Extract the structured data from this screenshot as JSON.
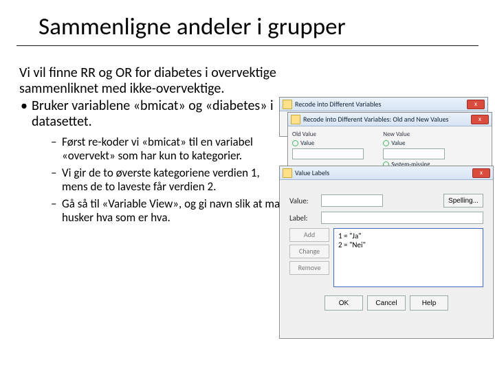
{
  "title": "Sammenligne andeler i grupper",
  "intro": "Vi vil finne RR og OR for diabetes i overvektige sammenliknet med ikke-overvektige.",
  "bullet": "Bruker variablene «bmicat» og «diabetes» i datasettet.",
  "subs": [
    "Først re-koder vi «bmicat» til en variabel «overvekt» som har kun to kategorier.",
    "Vi gir de to øverste kategoriene verdien 1, mens de to laveste får verdien 2.",
    "Gå så til «Variable View», og gi navn slik at man husker hva som er hva."
  ],
  "win1": {
    "title": "Recode into Different Variables",
    "close": "x"
  },
  "win2": {
    "title": "Recode into Different Variables: Old and New Values",
    "close": "x",
    "left_label": "Old Value",
    "right_label": "New Value",
    "opt_value": "Value",
    "opt_sysmiss": "System-missing"
  },
  "win3": {
    "title": "Value Labels",
    "close": "x",
    "value_label": "Value:",
    "label_label": "Label:",
    "spelling": "Spelling...",
    "btn_add": "Add",
    "btn_change": "Change",
    "btn_remove": "Remove",
    "val1": "1 = \"Ja\"",
    "val2": "2 = \"Nei\"",
    "ok": "OK",
    "cancel": "Cancel",
    "help": "Help"
  }
}
